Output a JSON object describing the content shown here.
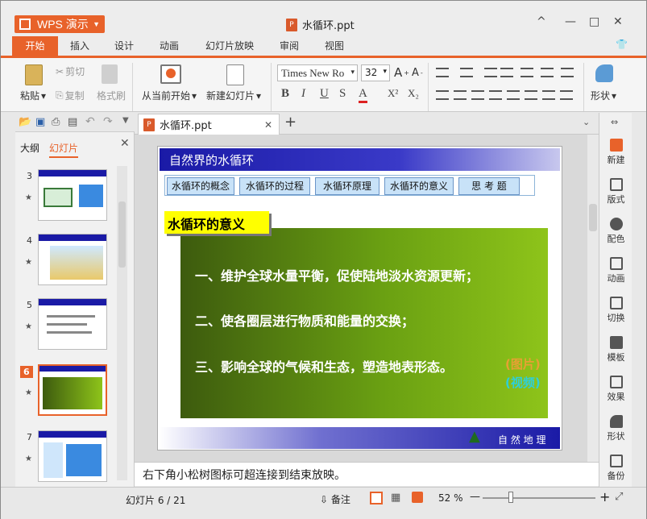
{
  "app": {
    "menu_label": "WPS 演示",
    "doc_title": "水循环.ppt"
  },
  "window_controls": {
    "restore": "^",
    "minimize": "—",
    "maximize": "□",
    "close": "✕"
  },
  "menu": {
    "tabs": [
      "开始",
      "插入",
      "设计",
      "动画",
      "幻灯片放映",
      "审阅",
      "视图"
    ]
  },
  "ribbon": {
    "paste": "粘贴",
    "cut": "剪切",
    "copy": "复制",
    "format_painter": "格式刷",
    "play_from_current": "从当前开始",
    "new_slide": "新建幻灯片",
    "font_name": "Times New Ro",
    "font_size": "32",
    "bold": "B",
    "italic": "I",
    "underline": "U",
    "font_color": "A",
    "superscript": "X²",
    "subscript": "X₂",
    "shapes": "形状"
  },
  "panel": {
    "tab_outline": "大纲",
    "tab_slides": "幻灯片",
    "slide_numbers": [
      "3",
      "4",
      "5",
      "6",
      "7"
    ],
    "current": "6"
  },
  "doc_tab": {
    "label": "水循环.ppt",
    "add": "+"
  },
  "slide": {
    "header": "自然界的水循环",
    "nav": [
      "水循环的概念",
      "水循环的过程",
      "水循环原理",
      "水循环的意义",
      "思 考 题"
    ],
    "section_label": "水循环的意义",
    "points": [
      "一、维护全球水量平衡，促使陆地淡水资源更新；",
      "二、使各圈层进行物质和能量的交换；",
      "三、影响全球的气候和生态，塑造地表形态。"
    ],
    "link_picture": "(图片)",
    "link_video": "(视频)",
    "footer": "自 然 地 理"
  },
  "notes": "右下角小松树图标可超连接到结束放映。",
  "right_bar": [
    "新建",
    "版式",
    "配色",
    "动画",
    "切换",
    "模板",
    "效果",
    "形状",
    "备份"
  ],
  "status": {
    "slide_counter": "幻灯片 6 / 21",
    "notes_btn": "备注",
    "zoom": "52 %"
  },
  "colors": {
    "accent": "#e8622a",
    "slide_blue": "#1a1aa6",
    "slide_green": "#6aa012",
    "nav_blue": "#c8e2f8"
  }
}
